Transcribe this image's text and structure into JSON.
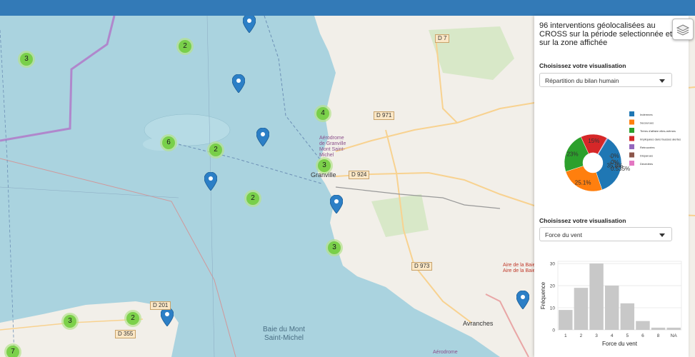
{
  "map": {
    "clusters": [
      "3",
      "2",
      "4",
      "6",
      "2",
      "3",
      "2",
      "3",
      "2",
      "3",
      "7"
    ],
    "places": {
      "granville": "Granville",
      "aerodrome1": "Aérodrome\nde Granville\nMont Saint-\nMichel",
      "baie": "Baie du Mont\nSaint-Michel",
      "avranches": "Avranches",
      "aire_baie": "Aire de la Baie\nAire de la Baie",
      "aerodrome2": "Aérodrome"
    },
    "roads": {
      "d7": "D 7",
      "d971": "D 971",
      "d924": "D 924",
      "d973": "D 973",
      "d201": "D 201",
      "d355": "D 355"
    },
    "layers_icon": "layers-icon",
    "pin_color": "#2c7fc6"
  },
  "panel": {
    "title": "96 interventions géolocalisées au CROSS sur la période selectionnée et sur la zone affichée",
    "section1_label": "Choisissez votre visualisation",
    "select1_value": "Répartition du bilan humain",
    "section2_label": "Choisissez votre visualisation",
    "select2_value": "Force du vent"
  },
  "chart_data": [
    {
      "type": "pie",
      "categories": [
        "Indemnes",
        "Secourues",
        "Tirées d'affaire elles-mêmes",
        "Impliquées dans fausses alertes",
        "Retrouvées",
        "Disparues",
        "Décédées"
      ],
      "values": [
        35.8,
        25.1,
        23.0,
        15.0,
        0.535,
        0.0,
        0.0
      ],
      "slice_labels": [
        "35.8%",
        "25.1%",
        "23%",
        "15%",
        "0.535%",
        "0%",
        "0%"
      ],
      "colors": [
        "#1f77b4",
        "#ff7f0e",
        "#2ca02c",
        "#d62728",
        "#9467bd",
        "#8c564b",
        "#e377c2"
      ],
      "donut": true
    },
    {
      "type": "bar",
      "categories": [
        "1",
        "2",
        "3",
        "4",
        "5",
        "6",
        "8",
        "NA"
      ],
      "values": [
        9,
        19,
        30,
        20,
        12,
        4,
        1,
        1
      ],
      "xlabel": "Force du vent",
      "ylabel": "Fréquence",
      "yticks": [
        0,
        10,
        20,
        30
      ],
      "ylim": [
        0,
        31
      ],
      "bar_color": "#c8c8c8"
    }
  ]
}
